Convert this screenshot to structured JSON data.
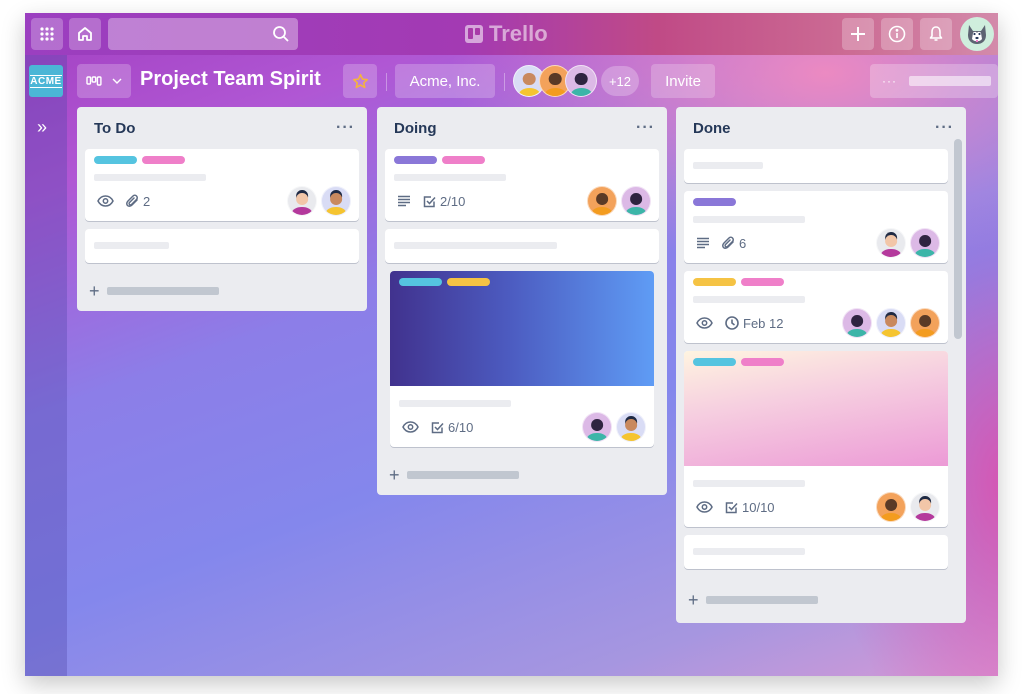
{
  "app": {
    "name": "Trello",
    "search": {
      "placeholder": ""
    },
    "top_icons": [
      "apps-grid-icon",
      "home-icon",
      "search-icon",
      "plus-icon",
      "info-icon",
      "bell-icon",
      "user-avatar"
    ]
  },
  "sidebar": {
    "workspace_logo": "ACME",
    "expand_label": "»"
  },
  "board": {
    "title": "Project Team Spirit",
    "view_icon": "board-view-icon",
    "starred": true,
    "workspace": "Acme, Inc.",
    "member_overflow": "+12",
    "invite_label": "Invite",
    "menu_label": "···"
  },
  "colors": {
    "label_cyan": "#55c4e0",
    "label_pink": "#ef7fc9",
    "label_purple": "#8a77d8",
    "label_yellow": "#f5c344",
    "text_primary": "#253858",
    "text_secondary": "#5e6c84",
    "list_bg": "#ebecf0"
  },
  "lists": [
    {
      "title": "To Do",
      "menu": "···",
      "cards": [
        {
          "labels": [
            "cyan",
            "pink"
          ],
          "badges": [
            {
              "icon": "eye-icon",
              "text": ""
            },
            {
              "icon": "paperclip-icon",
              "text": "2"
            }
          ],
          "members": [
            "woman-magenta",
            "man-yellow"
          ]
        },
        {
          "labels": [],
          "badges": [],
          "members": []
        }
      ]
    },
    {
      "title": "Doing",
      "menu": "···",
      "cards": [
        {
          "labels": [
            "purple",
            "pink"
          ],
          "badges": [
            {
              "icon": "description-icon",
              "text": ""
            },
            {
              "icon": "checklist-icon",
              "text": "2/10"
            }
          ],
          "members": [
            "man-beard-orange",
            "woman-teal"
          ]
        },
        {
          "labels": [],
          "badges": [],
          "members": []
        },
        {
          "cover": "blue-gradient",
          "labels": [
            "cyan",
            "yellow"
          ],
          "badges": [
            {
              "icon": "eye-icon",
              "text": ""
            },
            {
              "icon": "checklist-icon",
              "text": "6/10"
            }
          ],
          "members": [
            "woman-teal",
            "man-yellow"
          ]
        }
      ]
    },
    {
      "title": "Done",
      "menu": "···",
      "cards": [
        {
          "labels": [],
          "badges": [],
          "members": []
        },
        {
          "labels": [
            "purple"
          ],
          "badges": [
            {
              "icon": "description-icon",
              "text": ""
            },
            {
              "icon": "paperclip-icon",
              "text": "6"
            }
          ],
          "members": [
            "woman-magenta",
            "woman-teal"
          ]
        },
        {
          "labels": [
            "yellow",
            "pink"
          ],
          "badges": [
            {
              "icon": "eye-icon",
              "text": ""
            },
            {
              "icon": "clock-icon",
              "text": "Feb 12"
            }
          ],
          "members": [
            "woman-teal",
            "man-yellow",
            "man-beard-orange"
          ]
        },
        {
          "cover": "pink-gradient",
          "labels": [
            "cyan",
            "pink"
          ],
          "badges": [
            {
              "icon": "eye-icon",
              "text": ""
            },
            {
              "icon": "checklist-icon",
              "text": "10/10"
            }
          ],
          "members": [
            "man-beard-orange",
            "woman-magenta"
          ]
        },
        {
          "labels": [],
          "badges": [],
          "members": []
        }
      ]
    }
  ]
}
